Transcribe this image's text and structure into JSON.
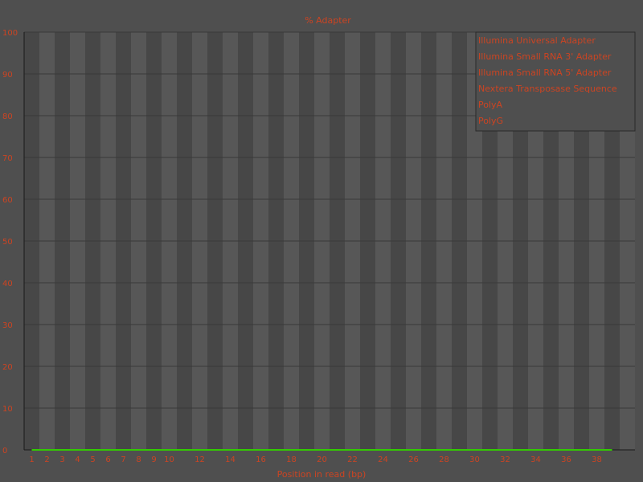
{
  "chart_data": {
    "type": "line",
    "title": "% Adapter",
    "xlabel": "Position in read (bp)",
    "ylabel": "",
    "ylim": [
      0,
      100
    ],
    "yticks": [
      0,
      10,
      20,
      30,
      40,
      50,
      60,
      70,
      80,
      90,
      100
    ],
    "categories": [
      "1",
      "2",
      "3",
      "4",
      "5",
      "6",
      "7",
      "8",
      "9",
      "10",
      "11",
      "12",
      "13",
      "14",
      "15",
      "16",
      "17",
      "18",
      "19",
      "20",
      "21",
      "22",
      "23",
      "24",
      "25",
      "26",
      "27",
      "28",
      "29",
      "30",
      "31",
      "32",
      "33",
      "34",
      "35",
      "36",
      "37",
      "38",
      "39"
    ],
    "xtick_labels": [
      "1",
      "2",
      "3",
      "4",
      "5",
      "6",
      "7",
      "8",
      "9",
      "10",
      "12",
      "14",
      "16",
      "18",
      "20",
      "22",
      "24",
      "26",
      "28",
      "30",
      "32",
      "34",
      "36",
      "38"
    ],
    "grid": true,
    "legend_position": "top-right",
    "series": [
      {
        "name": "Illumina Universal Adapter",
        "values": [
          0,
          0,
          0,
          0,
          0,
          0,
          0,
          0,
          0,
          0,
          0,
          0,
          0,
          0,
          0,
          0,
          0,
          0,
          0,
          0,
          0,
          0,
          0,
          0,
          0,
          0,
          0,
          0,
          0,
          0,
          0,
          0,
          0,
          0,
          0,
          0,
          0,
          0,
          0
        ]
      },
      {
        "name": "Illumina Small RNA 3' Adapter",
        "values": [
          0,
          0,
          0,
          0,
          0,
          0,
          0,
          0,
          0,
          0,
          0,
          0,
          0,
          0,
          0,
          0,
          0,
          0,
          0,
          0,
          0,
          0,
          0,
          0,
          0,
          0,
          0,
          0,
          0,
          0,
          0,
          0,
          0,
          0,
          0,
          0,
          0,
          0,
          0
        ]
      },
      {
        "name": "Illumina Small RNA 5' Adapter",
        "values": [
          0,
          0,
          0,
          0,
          0,
          0,
          0,
          0,
          0,
          0,
          0,
          0,
          0,
          0,
          0,
          0,
          0,
          0,
          0,
          0,
          0,
          0,
          0,
          0,
          0,
          0,
          0,
          0,
          0,
          0,
          0,
          0,
          0,
          0,
          0,
          0,
          0,
          0,
          0
        ]
      },
      {
        "name": "Nextera Transposase Sequence",
        "values": [
          0,
          0,
          0,
          0,
          0,
          0,
          0,
          0,
          0,
          0,
          0,
          0,
          0,
          0,
          0,
          0,
          0,
          0,
          0,
          0,
          0,
          0,
          0,
          0,
          0,
          0,
          0,
          0,
          0,
          0,
          0,
          0,
          0,
          0,
          0,
          0,
          0,
          0,
          0
        ]
      },
      {
        "name": "PolyA",
        "values": [
          0,
          0,
          0,
          0,
          0,
          0,
          0,
          0,
          0,
          0,
          0,
          0,
          0,
          0,
          0,
          0,
          0,
          0,
          0,
          0,
          0,
          0,
          0,
          0,
          0,
          0,
          0,
          0,
          0,
          0,
          0,
          0,
          0,
          0,
          0,
          0,
          0,
          0,
          0
        ]
      },
      {
        "name": "PolyG",
        "values": [
          0,
          0,
          0,
          0,
          0,
          0,
          0,
          0,
          0,
          0,
          0,
          0,
          0,
          0,
          0,
          0,
          0,
          0,
          0,
          0,
          0,
          0,
          0,
          0,
          0,
          0,
          0,
          0,
          0,
          0,
          0,
          0,
          0,
          0,
          0,
          0,
          0,
          0,
          0
        ]
      }
    ]
  },
  "colors": {
    "background": "#4f4f4f",
    "band_dark": "#474747",
    "band_light": "#575757",
    "gridline": "#3a3a3a",
    "axis": "#1a1a1a",
    "text": "#cc4422",
    "line": "#33cc00",
    "legend_bg": "#4f4f4f",
    "legend_border": "#2a2a2a"
  }
}
